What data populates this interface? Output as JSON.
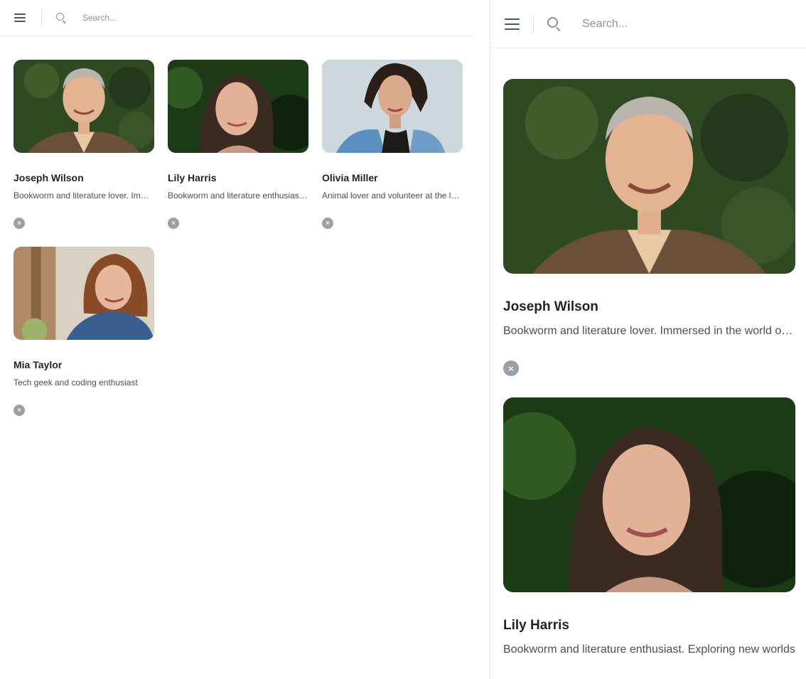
{
  "search": {
    "placeholder": "Search..."
  },
  "icons": {
    "menu": "menu-icon",
    "search": "search-icon",
    "remove": "close-circle-icon"
  },
  "people": [
    {
      "name": "Joseph Wilson",
      "bio": "Bookworm and literature lover. Immersed in the world of books",
      "photo": "older-man-smiling-in-blazer"
    },
    {
      "name": "Lily Harris",
      "bio": "Bookworm and literature enthusiast. Exploring new worlds",
      "photo": "woman-with-long-dark-hair-smiling"
    },
    {
      "name": "Olivia Miller",
      "bio": "Animal lover and volunteer at the local shelter",
      "photo": "young-woman-in-denim-jacket"
    },
    {
      "name": "Mia Taylor",
      "bio": "Tech geek and coding enthusiast",
      "photo": "woman-with-auburn-hair-in-denim-shirt"
    }
  ],
  "remove_glyph": "×",
  "colors": {
    "remove_badge": "#9aa0a7",
    "divider": "#e3e5e8"
  }
}
